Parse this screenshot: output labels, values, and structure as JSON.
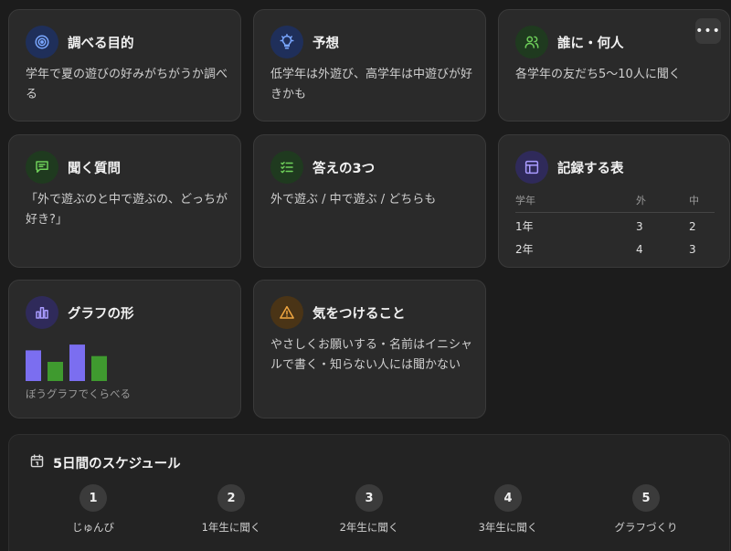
{
  "cards": {
    "purpose": {
      "title": "調べる目的",
      "body": "学年で夏の遊びの好みがちがうか調べる"
    },
    "prediction": {
      "title": "予想",
      "body": "低学年は外遊び、高学年は中遊びが好きかも"
    },
    "who": {
      "title": "誰に・何人",
      "body": "各学年の友だち5〜10人に聞く"
    },
    "question": {
      "title": "聞く質問",
      "body": "「外で遊ぶのと中で遊ぶの、どっちが好き?」"
    },
    "answers": {
      "title": "答えの3つ",
      "body": "外で遊ぶ / 中で遊ぶ / どちらも"
    },
    "record": {
      "title": "記録する表",
      "table": {
        "headers": [
          "学年",
          "外",
          "中"
        ],
        "rows": [
          [
            "1年",
            "3",
            "2"
          ],
          [
            "2年",
            "4",
            "3"
          ]
        ]
      }
    },
    "graph": {
      "title": "グラフの形",
      "caption": "ぼうグラフでくらべる",
      "bars": [
        {
          "value": 0.8,
          "color": "#7b6ef0"
        },
        {
          "value": 0.5,
          "color": "#3f9a2f"
        },
        {
          "value": 0.95,
          "color": "#7b6ef0"
        },
        {
          "value": 0.65,
          "color": "#3f9a2f"
        }
      ]
    },
    "caution": {
      "title": "気をつけること",
      "body": "やさしくお願いする・名前はイニシャルで書く・知らない人には聞かない"
    }
  },
  "more_button": {
    "label": "•••"
  },
  "schedule": {
    "title": "5日間のスケジュール",
    "steps": [
      {
        "num": "1",
        "label": "じゅんび"
      },
      {
        "num": "2",
        "label": "1年生に聞く"
      },
      {
        "num": "3",
        "label": "2年生に聞く"
      },
      {
        "num": "4",
        "label": "3年生に聞く"
      },
      {
        "num": "5",
        "label": "グラフづくり"
      }
    ]
  },
  "colors": {
    "blue_icon_bg": "#1f2f5a",
    "blue_icon": "#7aa7ff",
    "green_icon_bg": "#1f3a1f",
    "green_icon": "#6fd05a",
    "purple_icon_bg": "#2f2a5a",
    "purple_icon": "#a99bff",
    "orange_icon_bg": "#4a3416",
    "orange_icon": "#f0a640"
  }
}
